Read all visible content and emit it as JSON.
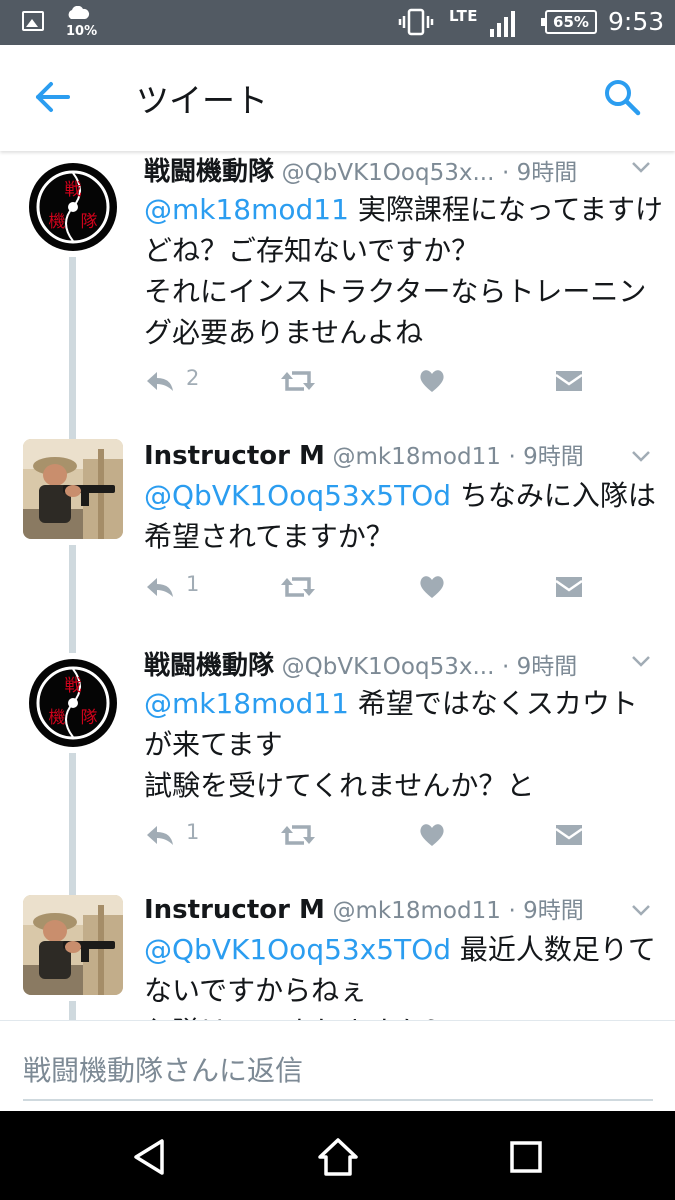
{
  "status_bar": {
    "weather_percent": "10%",
    "network": "LTE",
    "battery": "65%",
    "time": "9:53"
  },
  "header": {
    "title": "ツイート"
  },
  "tweets": [
    {
      "avatar": "emblem",
      "name": "戦闘機動隊",
      "handle": "@QbVK1Ooq53x...",
      "time": "· 9時間",
      "mention": "@mk18mod11",
      "text": " 実際課程になってますけどね？ご存知ないですか？\nそれにインストラクターならトレーニング必要ありませんよね",
      "reply_count": "2"
    },
    {
      "avatar": "soldier",
      "name": "Instructor M",
      "handle": "@mk18mod11",
      "time": "· 9時間",
      "mention": "@QbVK1Ooq53x5TOd",
      "text": " ちなみに入隊は希望されてますか？",
      "reply_count": "1"
    },
    {
      "avatar": "emblem",
      "name": "戦闘機動隊",
      "handle": "@QbVK1Ooq53x...",
      "time": "· 9時間",
      "mention": "@mk18mod11",
      "text": " 希望ではなくスカウトが来てます\n試験を受けてくれませんか？と",
      "reply_count": "1"
    },
    {
      "avatar": "soldier",
      "name": "Instructor M",
      "handle": "@mk18mod11",
      "time": "· 9時間",
      "mention": "@QbVK1Ooq53x5TOd",
      "text": " 最近人数足りてないですからねぇ\n入隊はいつされますか？",
      "reply_count": ""
    }
  ],
  "emblem_text": [
    "戦",
    "機",
    "隊"
  ],
  "reply_bar": {
    "placeholder": "戦闘機動隊さんに返信"
  },
  "colors": {
    "accent": "#2b9df0",
    "status_bar": "#525a63",
    "emblem_red": "#d0021b",
    "icon_gray": "#a1acb5",
    "thread_line": "#cfd9de"
  },
  "icons": {
    "back": "arrow-left-icon",
    "search": "search-icon",
    "reply": "reply-icon",
    "retweet": "retweet-icon",
    "like": "heart-icon",
    "dm": "envelope-icon",
    "more": "chevron-down-icon"
  }
}
